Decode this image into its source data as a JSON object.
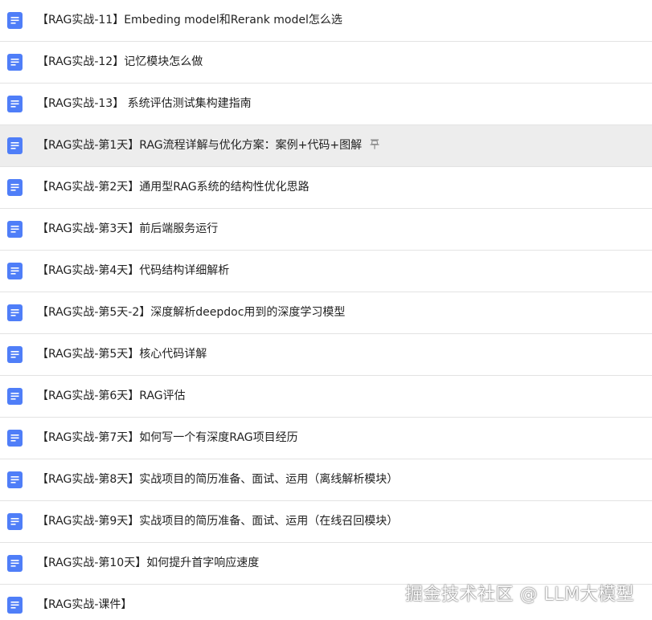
{
  "documents": [
    {
      "title": "【RAG实战-11】Embeding model和Rerank model怎么选",
      "icon": "doc-icon"
    },
    {
      "title": "【RAG实战-12】记忆模块怎么做",
      "icon": "doc-icon"
    },
    {
      "title": "【RAG实战-13】 系统评估测试集构建指南",
      "icon": "doc-icon"
    },
    {
      "title": "【RAG实战-第1天】RAG流程详解与优化方案：案例+代码+图解",
      "icon": "doc-icon",
      "pinned": true,
      "pin_icon": "pin-icon"
    },
    {
      "title": "【RAG实战-第2天】通用型RAG系统的结构性优化思路",
      "icon": "doc-icon"
    },
    {
      "title": "【RAG实战-第3天】前后端服务运行",
      "icon": "doc-icon"
    },
    {
      "title": "【RAG实战-第4天】代码结构详细解析",
      "icon": "doc-icon"
    },
    {
      "title": "【RAG实战-第5天-2】深度解析deepdoc用到的深度学习模型",
      "icon": "doc-icon"
    },
    {
      "title": "【RAG实战-第5天】核心代码详解",
      "icon": "doc-icon"
    },
    {
      "title": "【RAG实战-第6天】RAG评估",
      "icon": "doc-icon"
    },
    {
      "title": "【RAG实战-第7天】如何写一个有深度RAG项目经历",
      "icon": "doc-icon"
    },
    {
      "title": "【RAG实战-第8天】实战项目的简历准备、面试、运用（离线解析模块）",
      "icon": "doc-icon"
    },
    {
      "title": "【RAG实战-第9天】实战项目的简历准备、面试、运用（在线召回模块）",
      "icon": "doc-icon"
    },
    {
      "title": "【RAG实战-第10天】如何提升首字响应速度",
      "icon": "doc-icon"
    },
    {
      "title": "【RAG实战-课件】",
      "icon": "doc-icon"
    }
  ],
  "watermark": "掘金技术社区 @ LLM大模型",
  "colors": {
    "doc_icon": "#4f7ef8",
    "highlight_row": "#ededed",
    "divider": "#e3e3e3",
    "text": "#222222"
  }
}
